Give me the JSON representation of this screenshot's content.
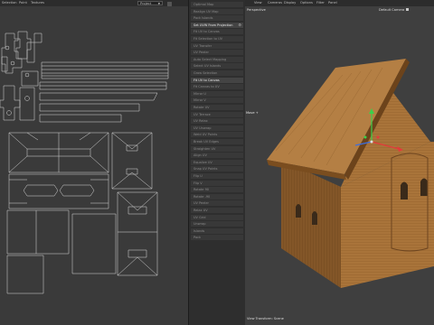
{
  "uv_editor": {
    "menu": [
      "Selection",
      "Point",
      "Textures"
    ],
    "projection_dropdown": "Project",
    "toolbar_icons": [
      "zoom-icon",
      "move-icon",
      "view-icon",
      "lock-icon"
    ]
  },
  "command_panel": {
    "items": [
      {
        "label": "Optimal Map",
        "active": false
      },
      {
        "label": "Realign UV Map",
        "active": false
      },
      {
        "label": "Pack Islands",
        "active": false
      },
      {
        "label": "Set UVW From Projection",
        "active": true,
        "gear": true
      },
      {
        "label": "Fit UV to Canvas",
        "active": false
      },
      {
        "label": "Fit Selection to UV",
        "active": false
      },
      {
        "label": "UV Transfer",
        "active": false
      },
      {
        "label": "UV Peeler",
        "active": false
      },
      {
        "label": "Auto Select Mapping",
        "active": false
      },
      {
        "label": "Select UV Islands",
        "active": false
      },
      {
        "label": "Grow Selection",
        "active": false
      },
      {
        "label": "Fit UV to Canvas",
        "active": true
      },
      {
        "label": "Fit Canvas to UV",
        "active": false
      },
      {
        "label": "Mirror U",
        "active": false
      },
      {
        "label": "Mirror V",
        "active": false
      },
      {
        "label": "Rotate UV",
        "active": false
      },
      {
        "label": "UV Terrace",
        "active": false
      },
      {
        "label": "UV Relax",
        "active": false
      },
      {
        "label": "UV Unwrap",
        "active": false
      },
      {
        "label": "Weld UV Points",
        "active": false
      },
      {
        "label": "Break UV Edges",
        "active": false
      },
      {
        "label": "Straighten UV",
        "active": false
      },
      {
        "label": "Align UV",
        "active": false
      },
      {
        "label": "Equalize UV",
        "active": false
      },
      {
        "label": "Snap UV Points",
        "active": false
      },
      {
        "label": "Flip U",
        "active": false
      },
      {
        "label": "Flip V",
        "active": false
      },
      {
        "label": "Rotate 90",
        "active": false
      },
      {
        "label": "Rotate -90",
        "active": false
      },
      {
        "label": "UV Peeler",
        "active": false
      },
      {
        "label": "Relax UV",
        "active": false
      },
      {
        "label": "UV Grid",
        "active": false
      },
      {
        "label": "Unwrap",
        "active": false
      },
      {
        "label": "Islands",
        "active": false
      },
      {
        "label": "Pack",
        "active": false
      }
    ]
  },
  "viewport": {
    "menu": [
      "View",
      "Cameras",
      "Display",
      "Options",
      "Filter",
      "Panel"
    ],
    "perspective_label": "Perspective",
    "camera_label": "Default Camera",
    "bottom_label": "View Transform: Scene",
    "tooltip": "Move +"
  },
  "colors": {
    "uv_wire": "#d8d8d8",
    "wood_light": "#b07a3e",
    "wood_dark": "#8a5a26",
    "axis_x": "#e23b3b",
    "axis_y": "#3bd14a",
    "axis_z": "#3b6ee2"
  }
}
